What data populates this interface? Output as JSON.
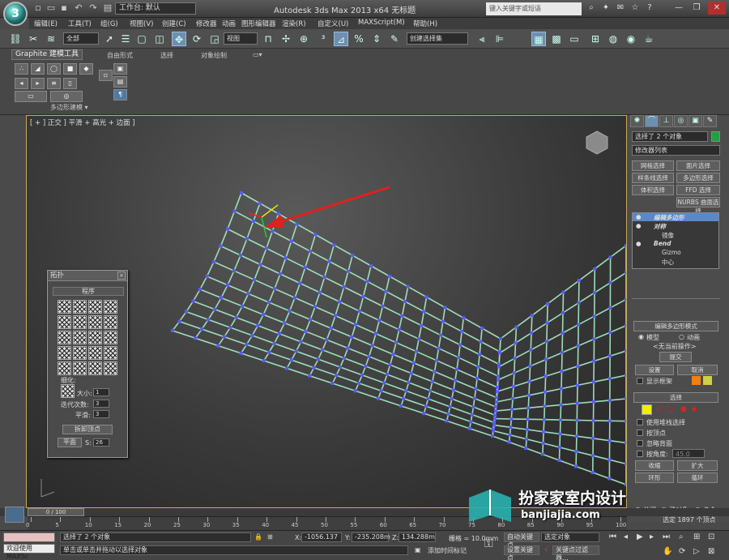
{
  "titlebar": {
    "logo": "3",
    "workspace": "工作台: 默认",
    "app_title": "Autodesk 3ds Max  2013 x64     无标题",
    "search_placeholder": "键入关键字或短语"
  },
  "menubar": [
    "编辑(E)",
    "工具(T)",
    "组(G)",
    "视图(V)",
    "创建(C)",
    "修改器",
    "动画",
    "图形编辑器",
    "渲染(R)",
    "自定义(U)",
    "MAXScript(M)",
    "帮助(H)"
  ],
  "toolbar": {
    "filter_select": "全部",
    "coord_select": "视图",
    "selset_select": "创建选择集"
  },
  "ribbon": {
    "tabs": [
      "Graphite 建模工具",
      "自由形式",
      "选择",
      "对象绘制"
    ],
    "panel_label": "多边形建模 ▾"
  },
  "viewport": {
    "label": "[ + ] 正交 ] 平滑 + 高光 + 边面 ]"
  },
  "topology": {
    "title": "拓扑",
    "section": "程序",
    "refine_label": "细化:",
    "size_label": "大小:",
    "size_value": "1",
    "iter_label": "迭代次数:",
    "iter_value": "3",
    "smooth_label": "平滑:",
    "smooth_value": "3",
    "remove_btn": "拆卸顶点",
    "plane_btn": "平面",
    "s_label": "S:",
    "s_value": "26"
  },
  "cmdpanel": {
    "selected": "选择了 2 个对象",
    "modlist": "修改器列表",
    "buttons": [
      "网格选择",
      "面片选择",
      "样条线选择",
      "多边形选择",
      "体积选择",
      "FFD 选择",
      "NURBS 曲面选择"
    ],
    "stack": [
      "编辑多边形",
      "对称",
      "镜像",
      "Bend",
      "Gizmo",
      "中心"
    ],
    "epm_header": "编辑多边形模式",
    "model": "模型",
    "anim": "动画",
    "no_op": "<无当前操作>",
    "commit": "提交",
    "settings": "设置",
    "cancel": "取消",
    "show_cage": "显示框架",
    "sel_header": "选择",
    "use_stack": "使用堆栈选择",
    "by_vertex": "按顶点",
    "ignore_back": "忽略背面",
    "by_angle": "按角度:",
    "angle_value": "45.0",
    "shrink": "收缩",
    "grow": "扩大",
    "ring": "环形",
    "loop": "循环",
    "off": "关闭",
    "subobj": "子对象",
    "multi": "多个",
    "selected_verts": "选定 1897 个顶点"
  },
  "timeline": {
    "frame": "0 / 100",
    "ticks": [
      "0",
      "5",
      "10",
      "15",
      "20",
      "25",
      "30",
      "35",
      "40",
      "45",
      "50",
      "55",
      "60",
      "65",
      "70",
      "75",
      "80",
      "85",
      "90",
      "95",
      "100"
    ]
  },
  "status": {
    "script_label": "欢迎使用 MAXSc",
    "line1": "选择了 2 个对象",
    "line2": "单击或单击并拖动以选择对象",
    "x_label": "X:",
    "x_value": "-1056.137",
    "y_label": "Y:",
    "y_value": "-235.208m",
    "z_label": "Z:",
    "z_value": "134.288m",
    "grid": "栅格 = 10.0mm",
    "add_time_tag": "添加时间标记",
    "autokey": "自动关键点",
    "setkey": "设置关键点",
    "selobj": "选定对象",
    "keyfilter": "关键点过滤器..."
  },
  "watermark": {
    "cn": "扮家家室内设计",
    "en": "banjiajia.com"
  }
}
